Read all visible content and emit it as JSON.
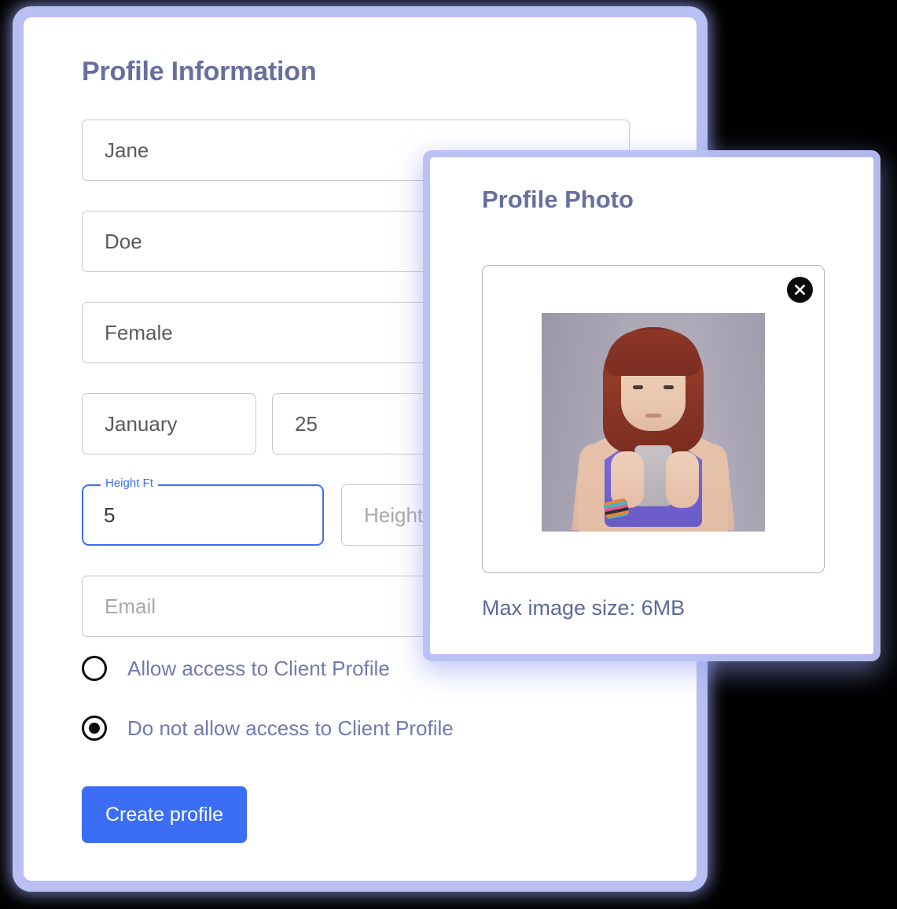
{
  "profile_card": {
    "title": "Profile Information",
    "fields": {
      "first_name": "Jane",
      "last_name": "Doe",
      "gender": "Female",
      "birth_month": "January",
      "birth_day": "25",
      "height_ft_label": "Height Ft",
      "height_ft_value": "5",
      "height_in_placeholder": "Height In",
      "email_placeholder": "Email"
    },
    "radios": [
      {
        "label": "Allow access to Client Profile",
        "selected": false
      },
      {
        "label": "Do not allow access to Client Profile",
        "selected": true
      }
    ],
    "submit_label": "Create profile"
  },
  "photo_card": {
    "title": "Profile Photo",
    "close_icon": "close-icon",
    "caption": "Max image size: 6MB",
    "photo_alt": "Woman with auburn bob haircut in purple sports bra holding a phone"
  },
  "colors": {
    "heading": "#676f9e",
    "accent_blue": "#3b6ef5",
    "radio_label": "#717ab0",
    "glow": "#b9bff2",
    "input_border": "#c8c8cc",
    "placeholder": "#a9a9ad"
  }
}
